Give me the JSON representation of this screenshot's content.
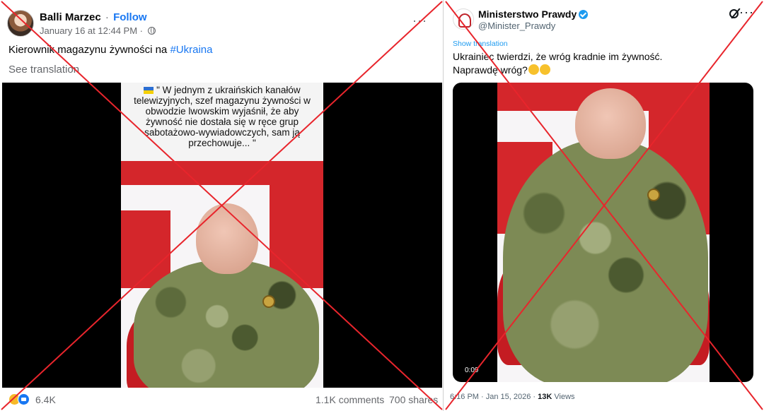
{
  "facebook_post": {
    "author": "Balli Marzec",
    "separator": "·",
    "follow_label": "Follow",
    "timestamp": "January 16 at 12:44 PM",
    "timestamp_separator": "·",
    "more_label": "···",
    "text_prefix": "Kierownik magazynu żywności na ",
    "hashtag": "#Ukraina",
    "see_translation": "See translation",
    "video_caption": "\" W jednym z ukraińskich kanałów telewizyjnych, szef magazynu żywności w obwodzie lwowskim wyjaśnił, że aby żywność nie dostała się w ręce grup sabotażowo-wywiadowczych, sam ją przechowuje... \"",
    "reaction_count": "6.4K",
    "comments": "1.1K comments",
    "shares": "700 shares"
  },
  "x_post": {
    "display_name": "Ministerstwo Prawdy",
    "handle": "@Minister_Prawdy",
    "more_label": "···",
    "show_translation": "Show translation",
    "text_line1": "Ukrainiec twierdzi, że wróg kradnie im żywność.",
    "text_line2": "Naprawdę wróg?",
    "video_duration": "0:09",
    "timestamp": "6:16 PM · Jan 15, 2026 ·",
    "views_count": "13K",
    "views_label": "Views"
  },
  "colors": {
    "fb_blue": "#1877f2",
    "x_blue": "#1d9bf0",
    "cross_red": "#e8252c"
  },
  "icons": [
    "globe-icon",
    "haha-reaction-icon",
    "like-reaction-icon",
    "verified-icon",
    "grok-icon",
    "more-icon"
  ]
}
